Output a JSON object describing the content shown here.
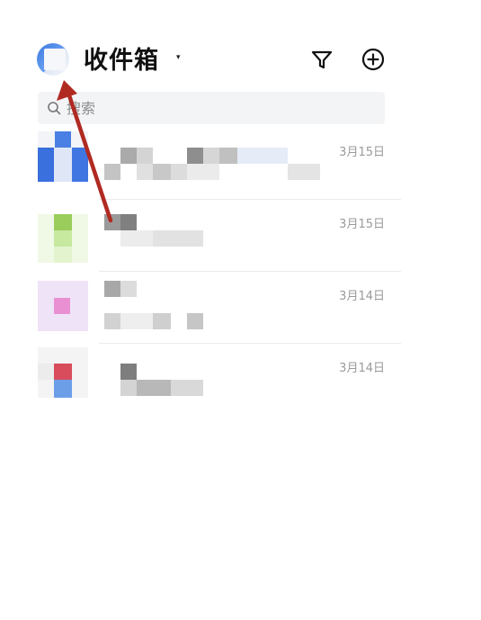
{
  "header": {
    "title": "收件箱",
    "dropdown_caret": "▾",
    "filter_icon": "filter-icon",
    "add_icon": "plus-circle-icon"
  },
  "search": {
    "placeholder": "搜索"
  },
  "mail_list": [
    {
      "date": "3月15日"
    },
    {
      "date": "3月15日"
    },
    {
      "date": "3月14日"
    },
    {
      "date": "3月14日"
    }
  ],
  "annotation": {
    "color": "#b02a22"
  }
}
